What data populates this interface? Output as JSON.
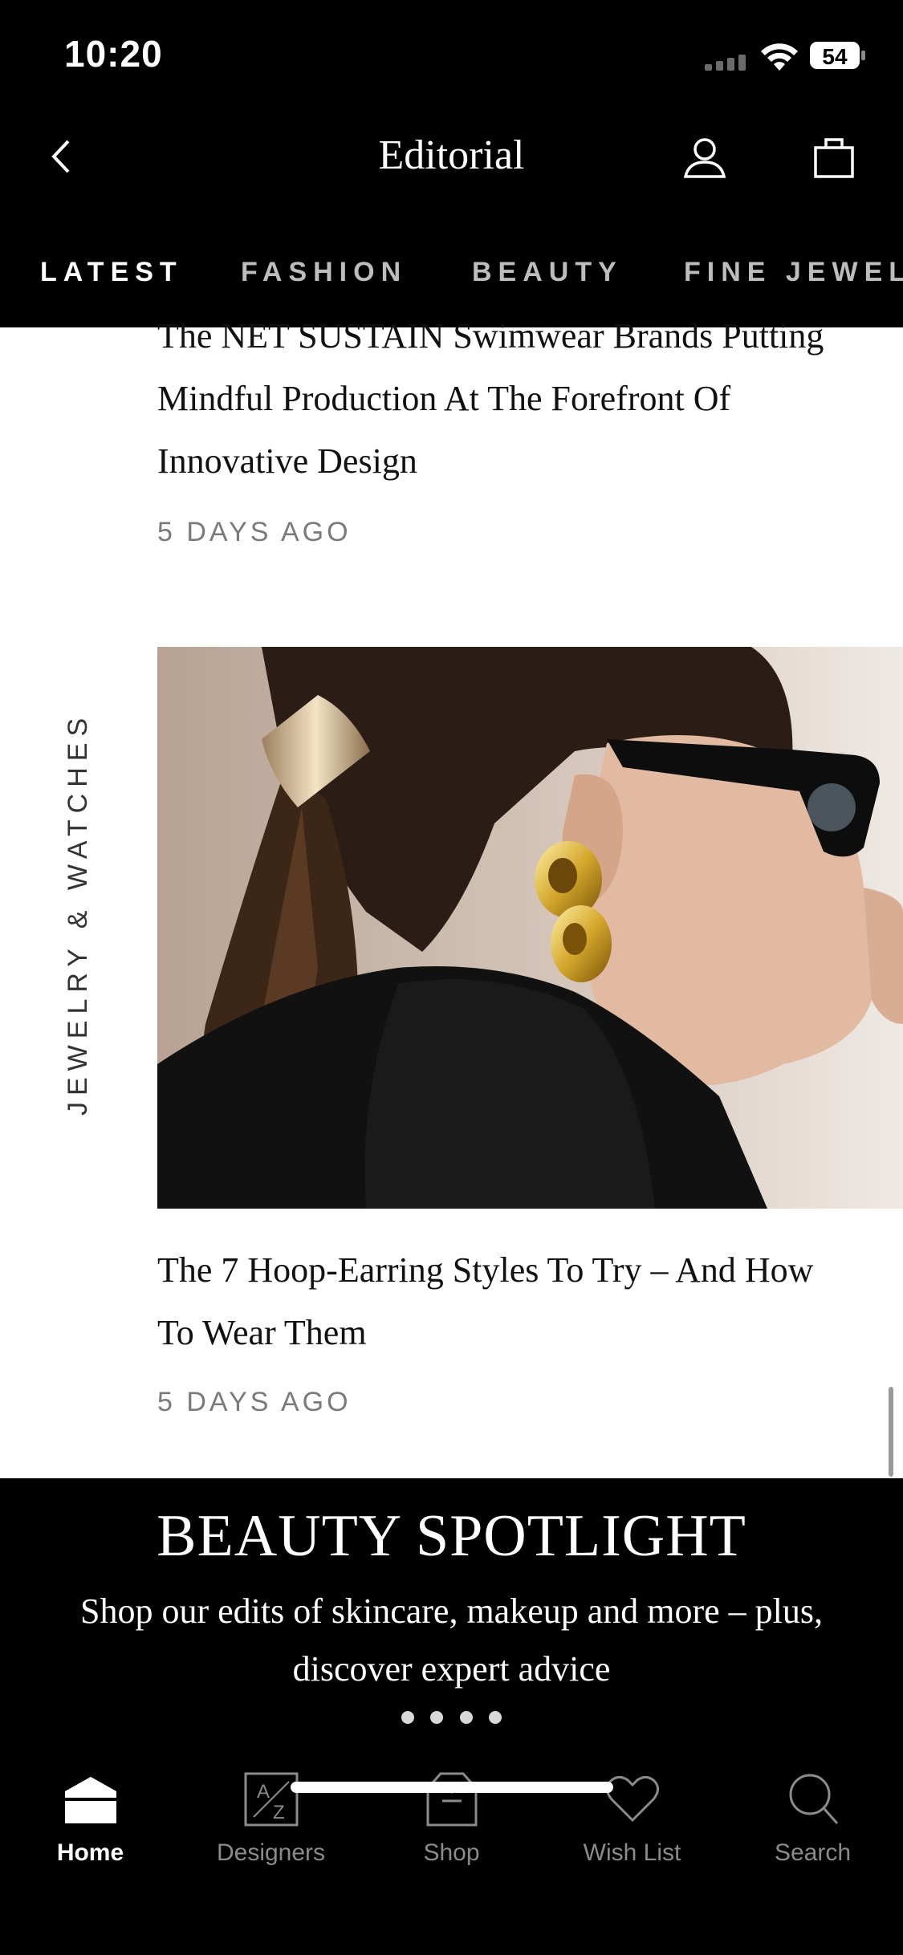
{
  "status_bar": {
    "time": "10:20",
    "battery": "54"
  },
  "header": {
    "title": "Editorial"
  },
  "tabs": [
    {
      "label": "LATEST",
      "active": true
    },
    {
      "label": "FASHION",
      "active": false
    },
    {
      "label": "BEAUTY",
      "active": false
    },
    {
      "label": "FINE JEWEL",
      "active": false
    }
  ],
  "articles": [
    {
      "title": "The NET SUSTAIN Swimwear Brands Putting Mindful Production At The Forefront Of Innovative Design",
      "time": "5 DAYS AGO"
    },
    {
      "category": "JEWELRY & WATCHES",
      "title": "The 7 Hoop-Earring Styles To Try – And How To Wear Them",
      "time": "5 DAYS AGO"
    }
  ],
  "banner": {
    "title": "BEAUTY SPOTLIGHT",
    "subtitle": "Shop our edits of skincare, makeup and more – plus, discover expert advice",
    "dots": 4
  },
  "bottom_nav": [
    {
      "label": "Home",
      "icon": "home-icon",
      "active": true
    },
    {
      "label": "Designers",
      "icon": "designers-az-icon",
      "active": false
    },
    {
      "label": "Shop",
      "icon": "shop-bag-icon",
      "active": false
    },
    {
      "label": "Wish List",
      "icon": "heart-icon",
      "active": false
    },
    {
      "label": "Search",
      "icon": "search-icon",
      "active": false
    }
  ],
  "colors": {
    "background": "#000000",
    "text": "#111111",
    "muted": "#7a7a7a",
    "tab_inactive": "#bdbdbd"
  }
}
